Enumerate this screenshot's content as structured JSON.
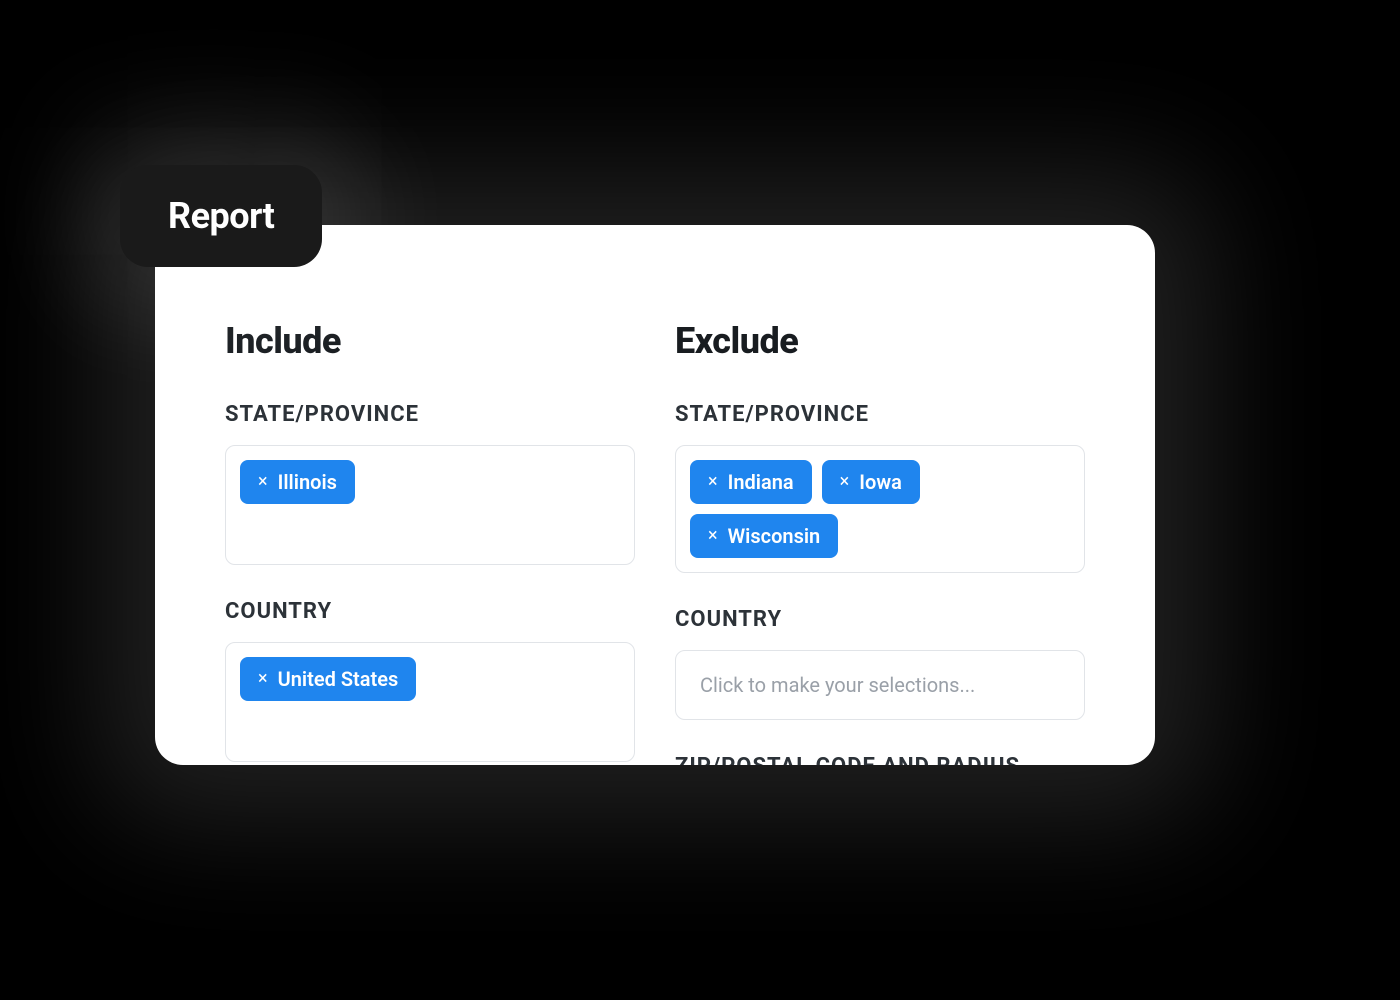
{
  "badge": {
    "label": "Report"
  },
  "columns": {
    "include": {
      "heading": "Include",
      "state_label": "STATE/PROVINCE",
      "state_tags": [
        "Illinois"
      ],
      "country_label": "COUNTRY",
      "country_tags": [
        "United States"
      ]
    },
    "exclude": {
      "heading": "Exclude",
      "state_label": "STATE/PROVINCE",
      "state_tags": [
        "Indiana",
        "Iowa",
        "Wisconsin"
      ],
      "country_label": "COUNTRY",
      "country_placeholder": "Click to make your selections...",
      "zip_label": "ZIP/POSTAL CODE AND RADIUS"
    }
  },
  "colors": {
    "tag_bg": "#1f85ee",
    "badge_bg": "#1a1a1a"
  }
}
